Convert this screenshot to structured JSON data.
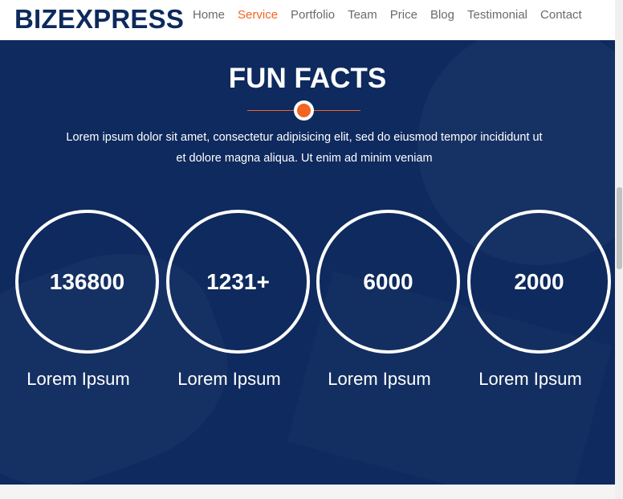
{
  "header": {
    "logo": "BIZEXPRESS",
    "nav": [
      {
        "label": "Home",
        "active": false
      },
      {
        "label": "Service",
        "active": true
      },
      {
        "label": "Portfolio",
        "active": false
      },
      {
        "label": "Team",
        "active": false
      },
      {
        "label": "Price",
        "active": false
      },
      {
        "label": "Blog",
        "active": false
      },
      {
        "label": "Testimonial",
        "active": false
      },
      {
        "label": "Contact",
        "active": false
      }
    ]
  },
  "funfacts": {
    "title": "FUN FACTS",
    "description_line1": "Lorem ipsum dolor sit amet, consectetur adipisicing elit, sed do eiusmod tempor incididunt ut",
    "description_line2": "et dolore magna aliqua. Ut enim ad minim veniam",
    "facts": [
      {
        "value": "136800",
        "label": "Lorem Ipsum"
      },
      {
        "value": "1231+",
        "label": "Lorem Ipsum"
      },
      {
        "value": "6000",
        "label": "Lorem Ipsum"
      },
      {
        "value": "2000",
        "label": "Lorem Ipsum"
      }
    ]
  },
  "colors": {
    "brand_navy": "#0d2a5c",
    "accent_orange": "#f26522",
    "hero_bg": "#0e2a5e"
  }
}
